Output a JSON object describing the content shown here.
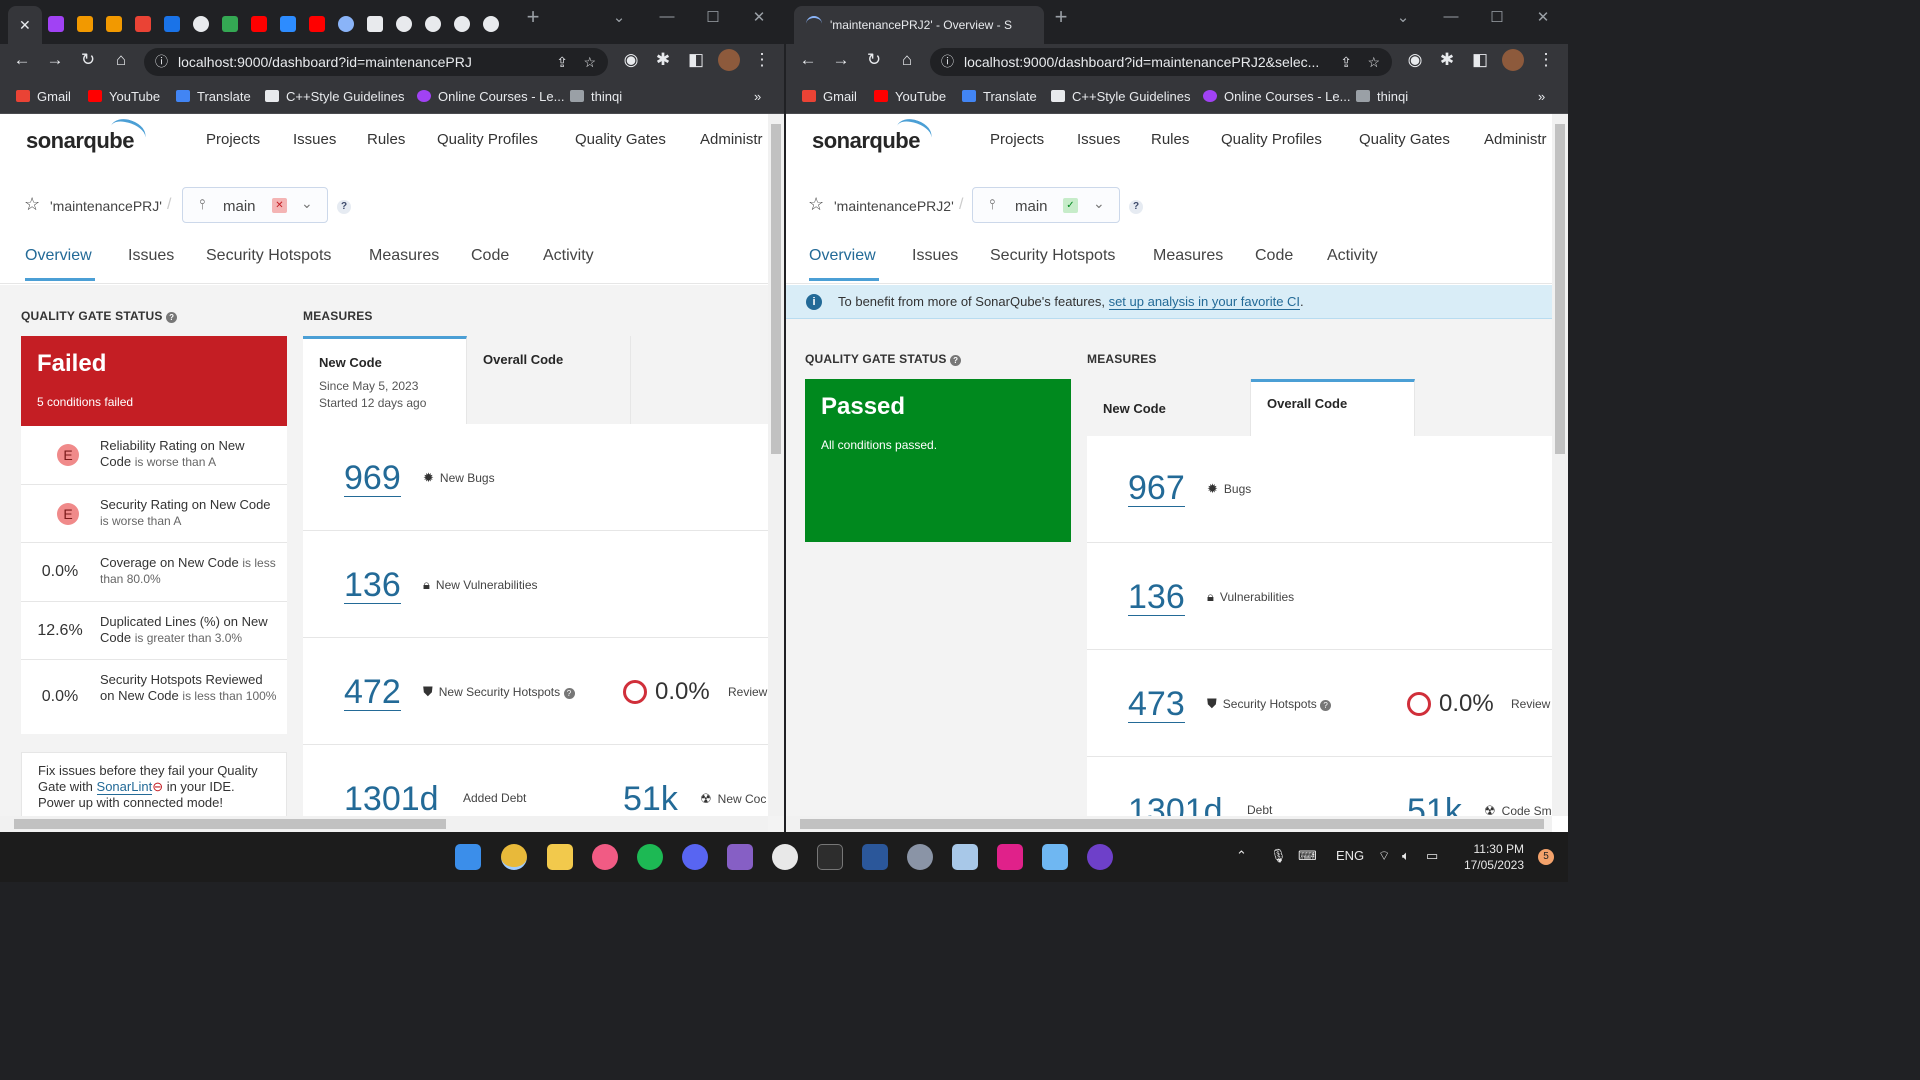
{
  "colors": {
    "failed": "#c41e24",
    "passed": "#00891e",
    "link": "#236a97",
    "accent": "#4b9fd5"
  },
  "left": {
    "tab_close": "✕",
    "url": "localhost:9000/dashboard?id=maintenancePRJ",
    "bookmarks": [
      "Gmail",
      "YouTube",
      "Translate",
      "C++Style Guidelines",
      "Online Courses - Le...",
      "thinqi"
    ],
    "nav": [
      "Projects",
      "Issues",
      "Rules",
      "Quality Profiles",
      "Quality Gates",
      "Administr"
    ],
    "logo": "sonarqube",
    "project": "'maintenancePRJ'",
    "branch": "main",
    "branch_status_icon": "✕",
    "help": "?",
    "tabs": [
      "Overview",
      "Issues",
      "Security Hotspots",
      "Measures",
      "Code",
      "Activity"
    ],
    "qg_title": "QUALITY GATE STATUS",
    "qg_status": "Failed",
    "qg_sub": "5 conditions failed",
    "conditions": [
      {
        "value": "E",
        "metric": "Reliability Rating on New Code",
        "detail": "is worse than A"
      },
      {
        "value": "E",
        "metric": "Security Rating on New Code",
        "detail": "is worse than A"
      },
      {
        "value": "0.0%",
        "metric": "Coverage on New Code",
        "detail": "is less than 80.0%"
      },
      {
        "value": "12.6%",
        "metric": "Duplicated Lines (%) on New Code",
        "detail": "is greater than 3.0%"
      },
      {
        "value": "0.0%",
        "metric": "Security Hotspots Reviewed on New Code",
        "detail": "is less than 100%"
      }
    ],
    "sonarlint": {
      "pre": "Fix issues before they fail your Quality Gate with ",
      "link": "SonarLint",
      "post": " in your IDE. Power up with connected mode!"
    },
    "measures_title": "MEASURES",
    "mtab_new": "New Code",
    "mtab_new_since": "Since May 5, 2023",
    "mtab_new_started": "Started 12 days ago",
    "mtab_overall": "Overall Code",
    "measures": [
      {
        "value": "969",
        "label": "New Bugs",
        "icon": "bug-icon"
      },
      {
        "value": "136",
        "label": "New Vulnerabilities",
        "icon": "lock-icon"
      },
      {
        "value": "472",
        "label": "New Security Hotspots",
        "icon": "shield-icon"
      },
      {
        "value": "1301d",
        "label": "Added Debt"
      }
    ],
    "hotspot_pct": "0.0%",
    "hotspot_review": "Review",
    "extra_value": "51k",
    "extra_label": "New Coc"
  },
  "right": {
    "tab_title": "'maintenancePRJ2' - Overview - S",
    "url": "localhost:9000/dashboard?id=maintenancePRJ2&selec...",
    "bookmarks": [
      "Gmail",
      "YouTube",
      "Translate",
      "C++Style Guidelines",
      "Online Courses - Le...",
      "thinqi"
    ],
    "nav": [
      "Projects",
      "Issues",
      "Rules",
      "Quality Profiles",
      "Quality Gates",
      "Administr"
    ],
    "logo": "sonarqube",
    "project": "'maintenancePRJ2'",
    "branch": "main",
    "branch_status_icon": "✓",
    "help": "?",
    "tabs": [
      "Overview",
      "Issues",
      "Security Hotspots",
      "Measures",
      "Code",
      "Activity"
    ],
    "banner_pre": "To benefit from more of SonarQube's features, ",
    "banner_link": "set up analysis in your favorite CI",
    "banner_post": ".",
    "qg_title": "QUALITY GATE STATUS",
    "qg_status": "Passed",
    "qg_sub": "All conditions passed.",
    "measures_title": "MEASURES",
    "mtab_new": "New Code",
    "mtab_overall": "Overall Code",
    "measures": [
      {
        "value": "967",
        "label": "Bugs",
        "icon": "bug-icon"
      },
      {
        "value": "136",
        "label": "Vulnerabilities",
        "icon": "lock-icon"
      },
      {
        "value": "473",
        "label": "Security Hotspots",
        "icon": "shield-icon"
      },
      {
        "value": "1301d",
        "label": "Debt"
      }
    ],
    "hotspot_pct": "0.0%",
    "hotspot_review": "Review",
    "extra_value": "51k",
    "extra_label": "Code Sm"
  },
  "taskbar": {
    "lang": "ENG",
    "time": "11:30 PM",
    "date": "17/05/2023",
    "notifications": "5"
  }
}
